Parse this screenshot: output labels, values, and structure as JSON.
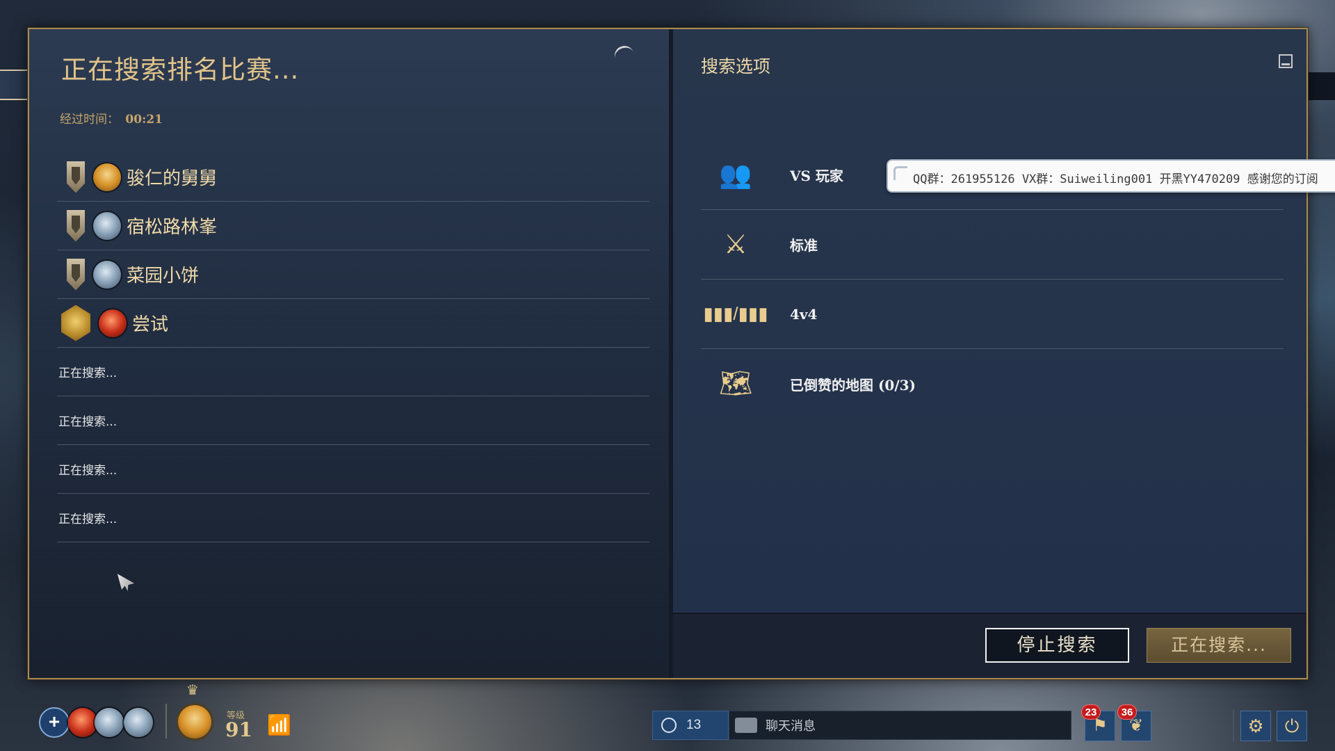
{
  "search_panel": {
    "title": "正在搜索排名比赛...",
    "elapsed_label": "经过时间：",
    "elapsed_value": "00:21",
    "players": [
      {
        "name": "骏仁的舅舅",
        "rank": "silver",
        "civ": "orange"
      },
      {
        "name": "宿松路林峯",
        "rank": "silver",
        "civ": "blue"
      },
      {
        "name": "菜园小饼",
        "rank": "silver",
        "civ": "blue"
      },
      {
        "name": "尝试",
        "rank": "gold",
        "civ": "red"
      }
    ],
    "searching_slots": [
      "正在搜索...",
      "正在搜索...",
      "正在搜索...",
      "正在搜索..."
    ]
  },
  "options_panel": {
    "title": "搜索选项",
    "options": [
      {
        "icon": "players-icon",
        "label": "VS 玩家"
      },
      {
        "icon": "crossed-swords-icon",
        "label": "标准"
      },
      {
        "icon": "team-size-icon",
        "label": "4v4"
      },
      {
        "icon": "map-icon",
        "label": "已倒赞的地图 (0/3)"
      }
    ]
  },
  "tooltip": {
    "text": "QQ群：261955126 VX群：Suiweiling001 开黑YY470209 感谢您的订阅"
  },
  "buttons": {
    "stop": "停止搜索",
    "searching": "正在搜索..."
  },
  "hud": {
    "add": "+",
    "level_label": "等级",
    "level_value": "91",
    "friends_count": "13",
    "chat_placeholder": "聊天消息",
    "notif_1_count": "23",
    "notif_2_count": "36"
  },
  "colors": {
    "gold_text": "#e2c48a",
    "frame_border": "#a88a52",
    "badge_red": "#c31d1d"
  }
}
